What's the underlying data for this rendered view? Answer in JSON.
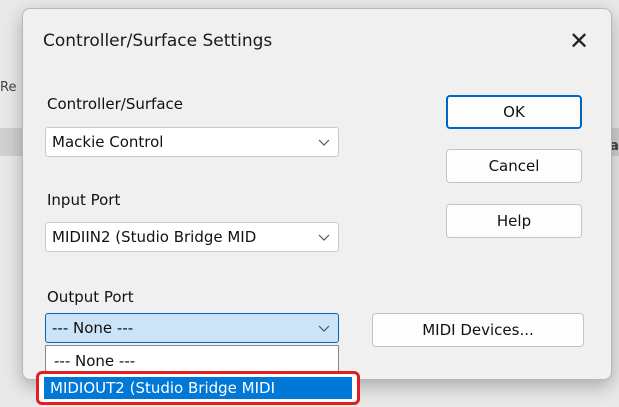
{
  "dialog": {
    "title": "Controller/Surface Settings",
    "close_glyph": "✕"
  },
  "background": {
    "left_fragment": "Re",
    "right_fragment": "Ca"
  },
  "controller_surface": {
    "label": "Controller/Surface",
    "value": "Mackie Control"
  },
  "input_port": {
    "label": "Input Port",
    "value": "MIDIIN2 (Studio Bridge MID"
  },
  "output_port": {
    "label": "Output Port",
    "value": "--- None ---"
  },
  "buttons": {
    "ok": "OK",
    "cancel": "Cancel",
    "help": "Help",
    "midi_devices": "MIDI Devices..."
  },
  "output_dropdown": {
    "options": [
      "--- None ---",
      "MIDIOUT2 (Studio Bridge MIDI"
    ],
    "selected_index": 1
  },
  "colors": {
    "accent": "#0067c0",
    "selection": "#0078d7",
    "annotation": "#e02020"
  },
  "icons": {
    "close": "close-icon",
    "chevron": "chevron-down-icon"
  }
}
